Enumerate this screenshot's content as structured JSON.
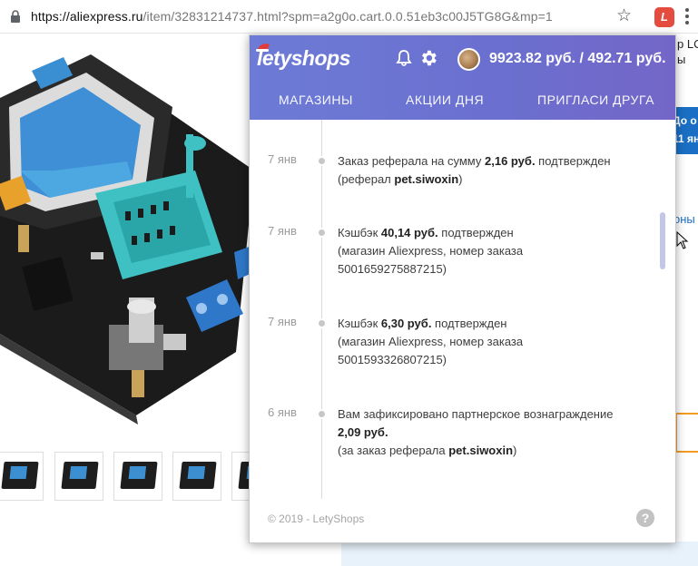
{
  "browser": {
    "url_host": "https://aliexpress.ru",
    "url_path": "/item/32831214737.html?spm=a2g0o.cart.0.0.51eb3c00J5TG8G&mp=1",
    "extension_label": "L",
    "star_icon": "star-icon",
    "lock_icon": "lock-icon"
  },
  "background_page": {
    "side_text_1": "р LC",
    "side_text_2": "ы",
    "promo_line_1": "До о",
    "promo_line_2": "11 ян",
    "link_text": "оны"
  },
  "popup": {
    "logo": "letyshops",
    "balance": "9923.82 руб. / 492.71 руб.",
    "nav": {
      "stores": "МАГАЗИНЫ",
      "deals": "АКЦИИ ДНЯ",
      "invite": "ПРИГЛАСИ ДРУГА"
    },
    "events": [
      {
        "date": "7 янв",
        "t1": "Заказ реферала на сумму ",
        "b1": "2,16 руб.",
        "t2": " подтвержден",
        "t3": "(реферал ",
        "b2": "pet.siwoxin",
        "t4": ")"
      },
      {
        "date": "7 янв",
        "t1": "Кэшбэк ",
        "b1": "40,14 руб.",
        "t2": " подтвержден",
        "t3": "(магазин Aliexpress, номер заказа",
        "t4": "5001659275887215)"
      },
      {
        "date": "7 янв",
        "t1": "Кэшбэк ",
        "b1": "6,30 руб.",
        "t2": " подтвержден",
        "t3": "(магазин Aliexpress, номер заказа",
        "t4": "5001593326807215)"
      },
      {
        "date": "6 янв",
        "t1": "Вам зафиксировано партнерское вознаграждение",
        "b1": "2,09 руб.",
        "t3": "(за заказ реферала ",
        "b2": "pet.siwoxin",
        "t4": ")"
      }
    ],
    "footer": "© 2019 - LetyShops",
    "help_label": "?"
  },
  "colors": {
    "header_start": "#6c7bd6",
    "header_end": "#7466c8",
    "extension": "#e34c3f",
    "scroll_thumb": "#c4c6e8"
  }
}
